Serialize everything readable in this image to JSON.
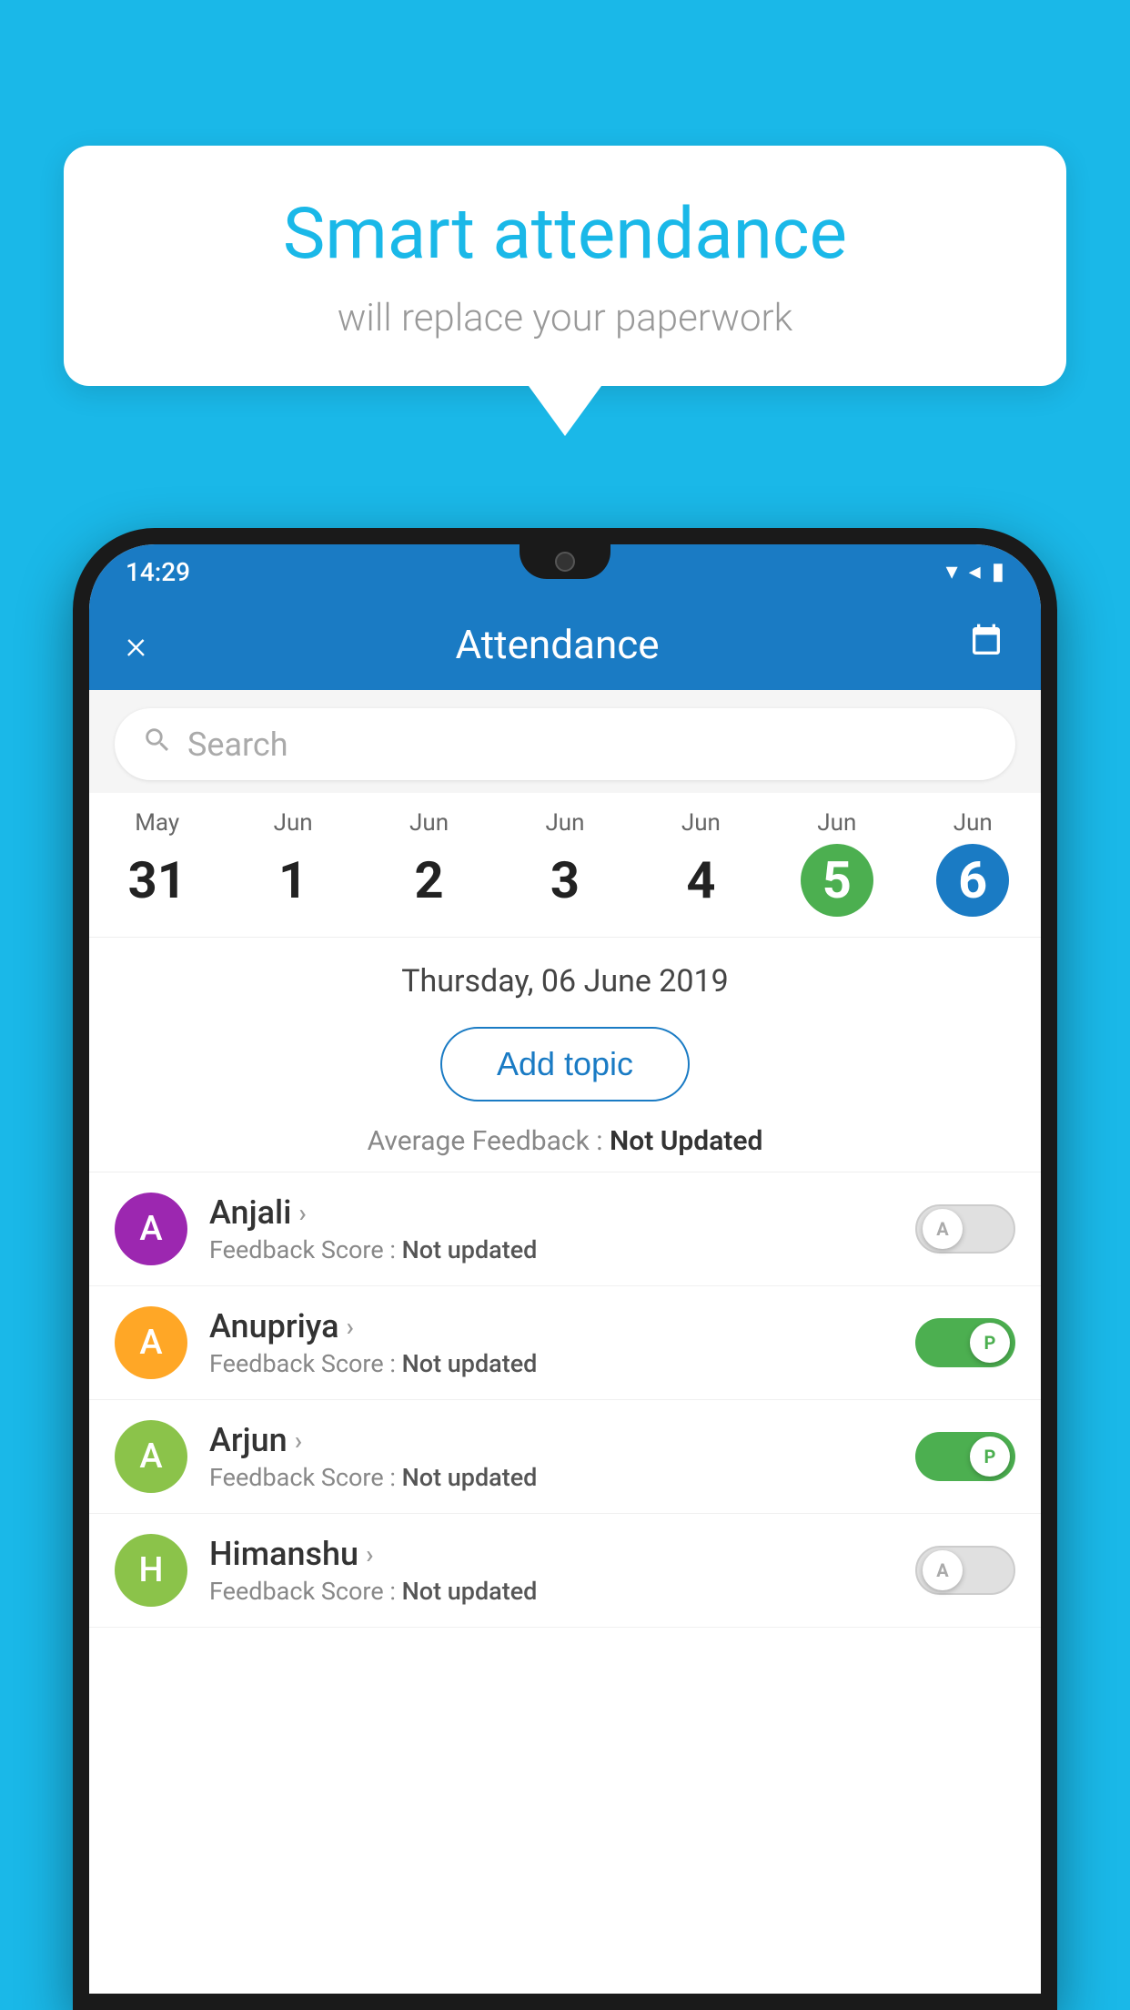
{
  "background_color": "#1ab8e8",
  "speech_bubble": {
    "title": "Smart attendance",
    "subtitle": "will replace your paperwork"
  },
  "status_bar": {
    "time": "14:29",
    "icons": "▾◂▮"
  },
  "header": {
    "title": "Attendance",
    "close_label": "×",
    "calendar_icon": "📅"
  },
  "search": {
    "placeholder": "Search"
  },
  "calendar": {
    "dates": [
      {
        "month": "May",
        "day": "31",
        "highlight": ""
      },
      {
        "month": "Jun",
        "day": "1",
        "highlight": ""
      },
      {
        "month": "Jun",
        "day": "2",
        "highlight": ""
      },
      {
        "month": "Jun",
        "day": "3",
        "highlight": ""
      },
      {
        "month": "Jun",
        "day": "4",
        "highlight": ""
      },
      {
        "month": "Jun",
        "day": "5",
        "highlight": "green"
      },
      {
        "month": "Jun",
        "day": "6",
        "highlight": "blue"
      }
    ]
  },
  "selected_date": "Thursday, 06 June 2019",
  "add_topic_label": "Add topic",
  "average_feedback": {
    "label": "Average Feedback : ",
    "value": "Not Updated"
  },
  "students": [
    {
      "name": "Anjali",
      "avatar_letter": "A",
      "avatar_color": "#9c27b0",
      "feedback_label": "Feedback Score : ",
      "feedback_value": "Not updated",
      "toggle_state": "off",
      "toggle_letter": "A"
    },
    {
      "name": "Anupriya",
      "avatar_letter": "A",
      "avatar_color": "#ffa726",
      "feedback_label": "Feedback Score : ",
      "feedback_value": "Not updated",
      "toggle_state": "on-green",
      "toggle_letter": "P"
    },
    {
      "name": "Arjun",
      "avatar_letter": "A",
      "avatar_color": "#8bc34a",
      "feedback_label": "Feedback Score : ",
      "feedback_value": "Not updated",
      "toggle_state": "on-green",
      "toggle_letter": "P"
    },
    {
      "name": "Himanshu",
      "avatar_letter": "H",
      "avatar_color": "#8bc34a",
      "feedback_label": "Feedback Score : ",
      "feedback_value": "Not updated",
      "toggle_state": "off",
      "toggle_letter": "A"
    }
  ]
}
